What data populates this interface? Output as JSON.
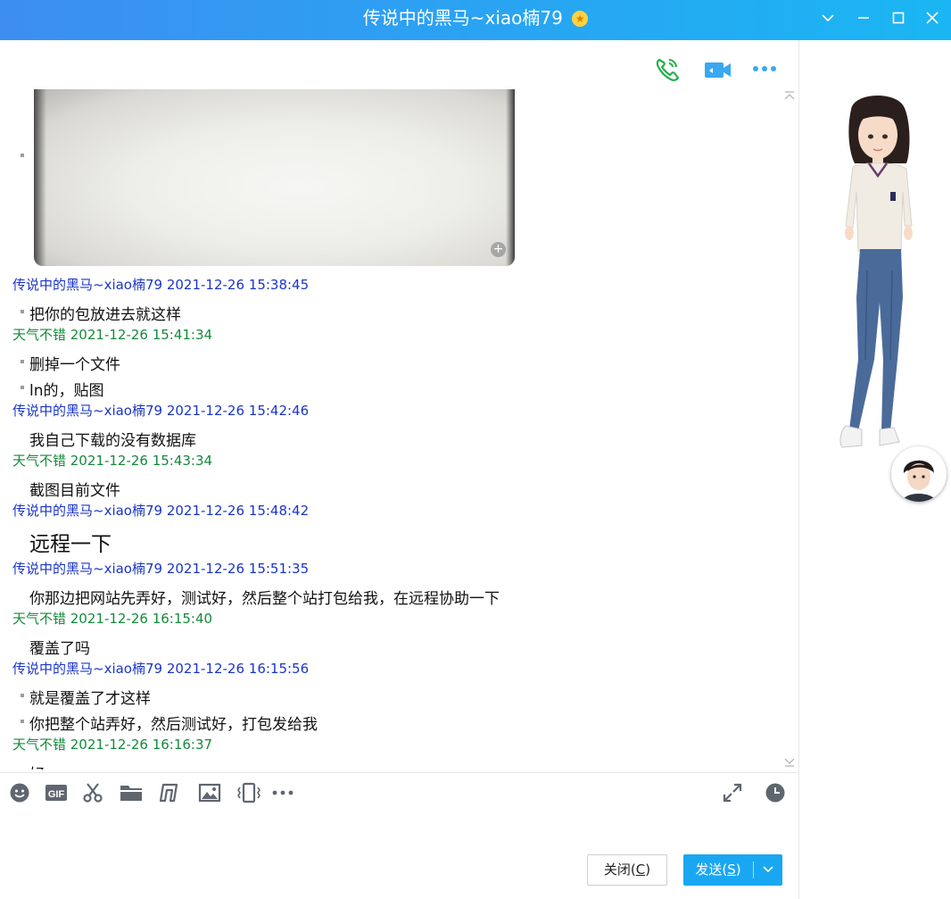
{
  "window": {
    "title": "传说中的黑马~xiao楠79",
    "star_glyph": "★",
    "controls": [
      "chevron-down-icon",
      "minimize-icon",
      "maximize-icon",
      "close-icon"
    ]
  },
  "top_actions": [
    "voice-call-icon",
    "video-call-icon",
    "more-icon"
  ],
  "image_message": {
    "zoom_glyph": "+"
  },
  "messages": [
    {
      "type": "header",
      "color": "blue",
      "text": "传说中的黑马~xiao楠79 2021-12-26 15:38:45"
    },
    {
      "type": "line",
      "bullet": true,
      "text": "把你的包放进去就这样"
    },
    {
      "type": "header",
      "color": "green",
      "text": "天气不错 2021-12-26 15:41:34"
    },
    {
      "type": "line",
      "bullet": true,
      "text": "删掉一个文件"
    },
    {
      "type": "line",
      "bullet": true,
      "text": "ln的，贴图"
    },
    {
      "type": "header",
      "color": "blue",
      "text": "传说中的黑马~xiao楠79 2021-12-26 15:42:46"
    },
    {
      "type": "line",
      "bullet": false,
      "text": "我自己下载的没有数据库"
    },
    {
      "type": "header",
      "color": "green",
      "text": "天气不错 2021-12-26 15:43:34"
    },
    {
      "type": "line",
      "bullet": false,
      "text": "截图目前文件"
    },
    {
      "type": "header",
      "color": "blue",
      "text": "传说中的黑马~xiao楠79 2021-12-26 15:48:42"
    },
    {
      "type": "line",
      "bullet": false,
      "big": true,
      "text": "远程一下"
    },
    {
      "type": "header",
      "color": "blue",
      "text": "传说中的黑马~xiao楠79 2021-12-26 15:51:35"
    },
    {
      "type": "line",
      "bullet": false,
      "text": "你那边把网站先弄好，测试好，然后整个站打包给我，在远程协助一下"
    },
    {
      "type": "header",
      "color": "green",
      "text": "天气不错 2021-12-26 16:15:40"
    },
    {
      "type": "line",
      "bullet": false,
      "text": "覆盖了吗"
    },
    {
      "type": "header",
      "color": "blue",
      "text": "传说中的黑马~xiao楠79 2021-12-26 16:15:56"
    },
    {
      "type": "line",
      "bullet": true,
      "text": "就是覆盖了才这样"
    },
    {
      "type": "line",
      "bullet": true,
      "text": "你把整个站弄好，然后测试好，打包发给我"
    },
    {
      "type": "header",
      "color": "green",
      "text": "天气不错 2021-12-26 16:16:37"
    },
    {
      "type": "line",
      "bullet": false,
      "text": "好"
    }
  ],
  "toolbar": {
    "left_icons": [
      "emoji-icon",
      "gif-icon",
      "scissors-icon",
      "folder-icon",
      "music-icon",
      "image-icon",
      "shake-icon",
      "more-icon"
    ],
    "right_icons": [
      "expand-icon",
      "history-icon"
    ],
    "gif_text": "GIF"
  },
  "input": {
    "value": "",
    "placeholder": ""
  },
  "buttons": {
    "close_label": "关闭(",
    "close_key": "C",
    "close_end": ")",
    "send_label": "发送(",
    "send_key": "S",
    "send_end": ")"
  },
  "colors": {
    "titlebar_start": "#3d8ef0",
    "titlebar_end": "#1ab6f3",
    "sender_blue": "#1a35c8",
    "sender_green": "#138a3a",
    "send_button": "#1aa7f2",
    "icon_blue": "#39a8f0",
    "icon_green": "#21b14b"
  }
}
